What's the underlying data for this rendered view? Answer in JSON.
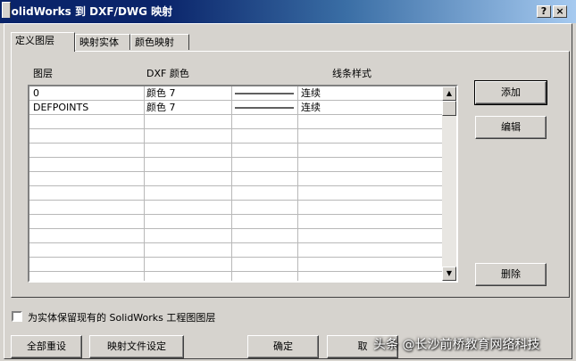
{
  "window": {
    "title": "SolidWorks 到 DXF/DWG 映射",
    "help_label": "?",
    "close_label": "×"
  },
  "tabs": [
    {
      "label": "定义图层"
    },
    {
      "label": "映射实体"
    },
    {
      "label": "颜色映射"
    }
  ],
  "table": {
    "columns": [
      "图层",
      "DXF 颜色",
      "线条样式"
    ],
    "rows": [
      {
        "layer": "0",
        "color": "颜色 7",
        "style": "连续"
      },
      {
        "layer": "DEFPOINTS",
        "color": "颜色 7",
        "style": "连续"
      }
    ]
  },
  "buttons": {
    "add": "添加",
    "edit": "编辑",
    "delete": "删除",
    "reset_all": "全部重设",
    "map_file_settings": "映射文件设定",
    "ok": "确定",
    "cancel": "取"
  },
  "checkbox": {
    "label": "为实体保留现有的 SolidWorks 工程图图层",
    "checked": false
  },
  "watermark": "头条 @长沙前桥教育网络科技"
}
